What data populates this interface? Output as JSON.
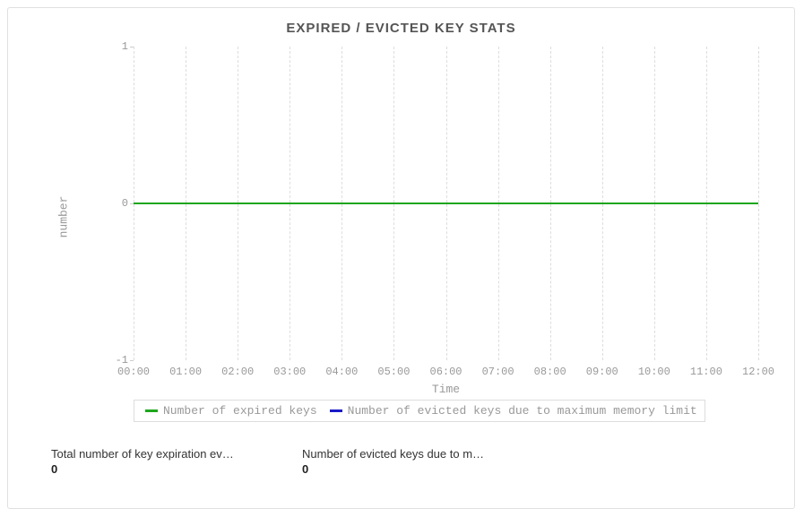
{
  "title": "EXPIRED / EVICTED KEY STATS",
  "xlabel": "Time",
  "ylabel": "number",
  "y_ticks": [
    "1",
    "0",
    "-1"
  ],
  "x_ticks": [
    "00:00",
    "01:00",
    "02:00",
    "03:00",
    "04:00",
    "05:00",
    "06:00",
    "07:00",
    "08:00",
    "09:00",
    "10:00",
    "11:00",
    "12:00"
  ],
  "legend": {
    "series1": "Number of expired keys",
    "series2": "Number of evicted keys due to maximum memory limit"
  },
  "stats": {
    "stat1_label": "Total number of key expiration ev…",
    "stat1_value": "0",
    "stat2_label": "Number of evicted keys due to m…",
    "stat2_value": "0"
  },
  "colors": {
    "expired": "#1ea61e",
    "evicted": "#1a1ac8"
  },
  "chart_data": {
    "type": "line",
    "title": "EXPIRED / EVICTED KEY STATS",
    "xlabel": "Time",
    "ylabel": "number",
    "ylim": [
      -1,
      1
    ],
    "x": [
      "00:00",
      "01:00",
      "02:00",
      "03:00",
      "04:00",
      "05:00",
      "06:00",
      "07:00",
      "08:00",
      "09:00",
      "10:00",
      "11:00",
      "12:00"
    ],
    "series": [
      {
        "name": "Number of expired keys",
        "color": "#1ea61e",
        "values": [
          0,
          0,
          0,
          0,
          0,
          0,
          0,
          0,
          0,
          0,
          0,
          0,
          0
        ]
      },
      {
        "name": "Number of evicted keys due to maximum memory limit",
        "color": "#1a1ac8",
        "values": [
          0,
          0,
          0,
          0,
          0,
          0,
          0,
          0,
          0,
          0,
          0,
          0,
          0
        ]
      }
    ]
  }
}
